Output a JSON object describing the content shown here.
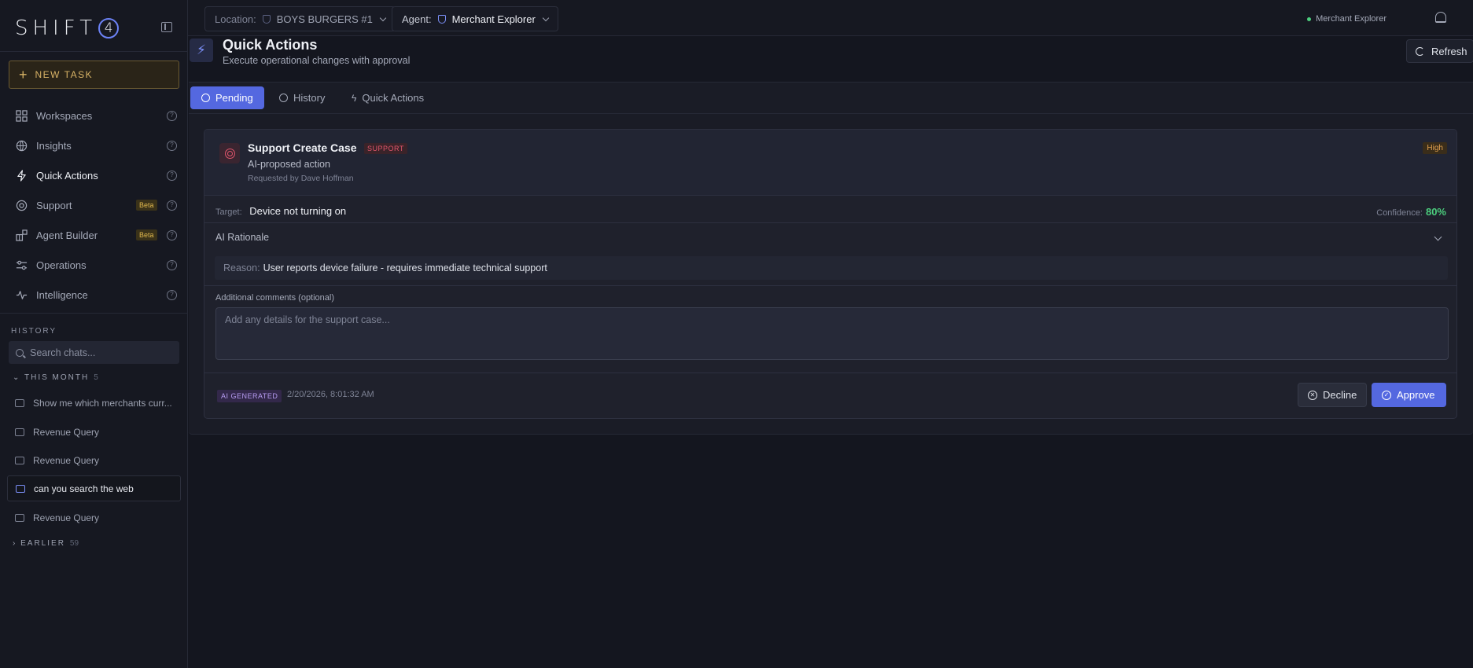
{
  "app": {
    "logo_text": "SHIFT",
    "logo_digit": "4"
  },
  "sidebar": {
    "new_task_label": "NEW TASK",
    "nav": [
      {
        "label": "Workspaces",
        "icon": "grid-icon"
      },
      {
        "label": "Insights",
        "icon": "globe-icon"
      },
      {
        "label": "Quick Actions",
        "icon": "bolt-icon",
        "active": true
      },
      {
        "label": "Support",
        "icon": "lifebuoy-icon",
        "badge": "Beta"
      },
      {
        "label": "Agent Builder",
        "icon": "blocks-icon",
        "badge": "Beta"
      },
      {
        "label": "Operations",
        "icon": "sliders-icon"
      },
      {
        "label": "Intelligence",
        "icon": "pulse-icon"
      }
    ],
    "history_title": "HISTORY",
    "search_placeholder": "Search chats...",
    "groups": {
      "this_month": {
        "label": "THIS MONTH",
        "count": "5"
      },
      "earlier": {
        "label": "EARLIER",
        "count": "59"
      }
    },
    "chats": [
      "Show me which merchants curr...",
      "Revenue Query",
      "Revenue Query",
      "can you search the web",
      "Revenue Query"
    ]
  },
  "topbar": {
    "location_label": "Location:",
    "location_value": "BOYS BURGERS #1",
    "agent_label": "Agent:",
    "agent_value": "Merchant Explorer",
    "status_text": "Merchant Explorer"
  },
  "page": {
    "title": "Quick Actions",
    "subtitle": "Execute operational changes with approval",
    "refresh_label": "Refresh",
    "tabs": [
      "Pending",
      "History",
      "Quick Actions"
    ]
  },
  "card": {
    "title": "Support Create Case",
    "tag": "SUPPORT",
    "subtitle": "AI-proposed action",
    "requested_by": "Requested by Dave Hoffman",
    "priority": "High",
    "target_label": "Target:",
    "target_value": "Device not turning on",
    "confidence_label": "Confidence:",
    "confidence_value": "80%",
    "rationale_label": "AI Rationale",
    "reason_label": "Reason:",
    "reason_value": "User reports device failure - requires immediate technical support",
    "comments_label": "Additional comments (optional)",
    "comments_placeholder": "Add any details for the support case...",
    "ai_badge": "AI GENERATED",
    "timestamp": "2/20/2026, 8:01:32 AM",
    "decline_label": "Decline",
    "approve_label": "Approve"
  },
  "colors": {
    "accent": "#5468e0",
    "new_task": "#d8b366",
    "confidence": "#4ccf7e",
    "support_tag": "#e0566c"
  }
}
